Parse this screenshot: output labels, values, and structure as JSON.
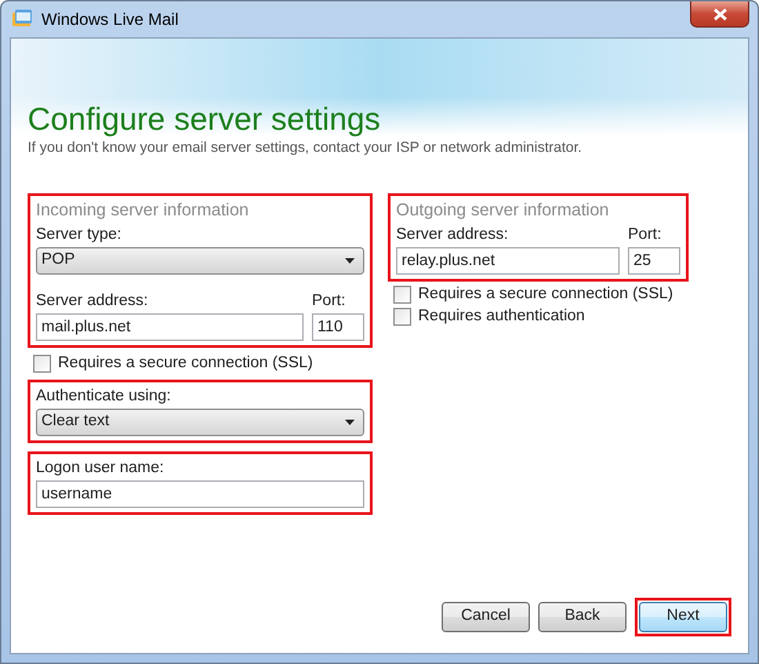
{
  "window": {
    "title": "Windows Live Mail"
  },
  "heading": "Configure server settings",
  "subtitle": "If you don't know your email server settings, contact your ISP or network administrator.",
  "incoming": {
    "highlighted": true,
    "title": "Incoming server information",
    "server_type_label": "Server type:",
    "server_type": "POP",
    "address_label": "Server address:",
    "address": "mail.plus.net",
    "port_label": "Port:",
    "port": "110"
  },
  "incoming_options": [
    {
      "label": "Requires a secure connection (SSL)",
      "checked": false
    }
  ],
  "authentication": {
    "highlighted": true,
    "label": "Authenticate using:",
    "value": "Clear text"
  },
  "logon": {
    "highlighted": true,
    "label": "Logon user name:",
    "value": "username"
  },
  "outgoing": {
    "highlighted": true,
    "title": "Outgoing server information",
    "address_label": "Server address:",
    "address": "relay.plus.net",
    "port_label": "Port:",
    "port": "25"
  },
  "outgoing_options": [
    {
      "label": "Requires a secure connection (SSL)",
      "checked": false
    },
    {
      "label": "Requires authentication",
      "checked": false
    }
  ],
  "buttons": [
    {
      "label": "Cancel",
      "default": false,
      "highlighted": false
    },
    {
      "label": "Back",
      "default": false,
      "highlighted": false
    },
    {
      "label": "Next",
      "default": true,
      "highlighted": true
    }
  ]
}
